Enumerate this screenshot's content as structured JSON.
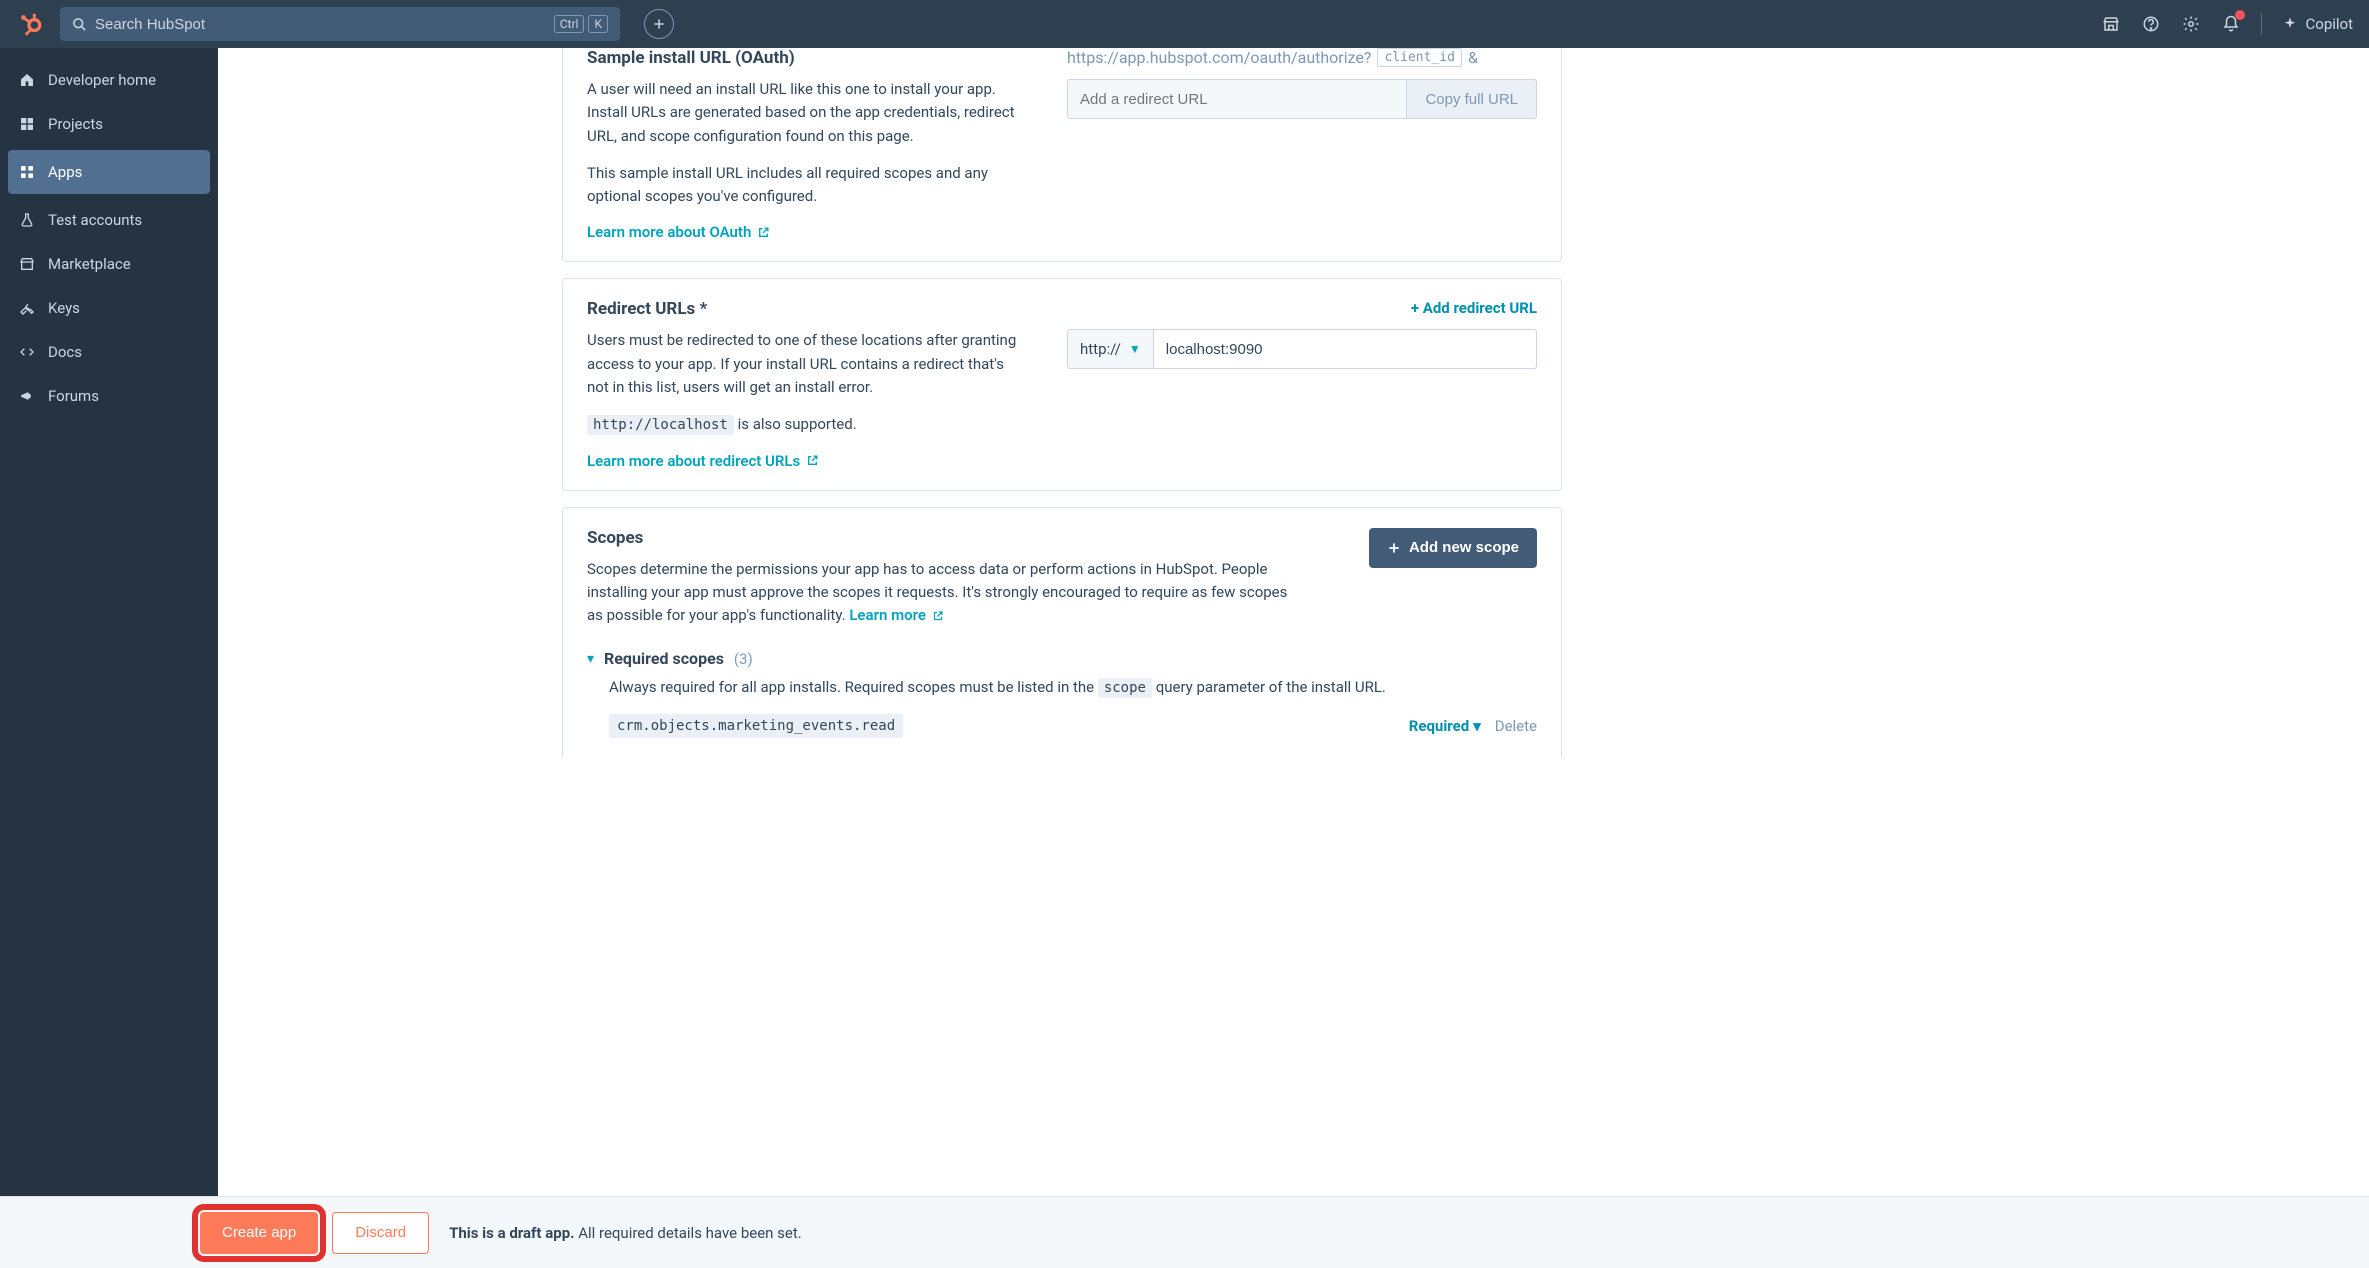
{
  "topbar": {
    "search_placeholder": "Search HubSpot",
    "kbd_ctrl": "Ctrl",
    "kbd_k": "K",
    "copilot_label": "Copilot"
  },
  "sidebar": {
    "items": [
      {
        "label": "Developer home"
      },
      {
        "label": "Projects"
      },
      {
        "label": "Apps"
      },
      {
        "label": "Test accounts"
      },
      {
        "label": "Marketplace"
      },
      {
        "label": "Keys"
      },
      {
        "label": "Docs"
      },
      {
        "label": "Forums"
      }
    ]
  },
  "oauth": {
    "title": "Sample install URL (OAuth)",
    "desc1": "A user will need an install URL like this one to install your app. Install URLs are generated based on the app credentials, redirect URL, and scope configuration found on this page.",
    "desc2": "This sample install URL includes all required scopes and any optional scopes you've configured.",
    "learn_more": "Learn more about OAuth",
    "url_prefix": "https://app.hubspot.com/oauth/authorize?",
    "url_chip": "client_id",
    "url_amp": "&",
    "input_placeholder": "Add a redirect URL",
    "copy_btn": "Copy full URL"
  },
  "redirect": {
    "title": "Redirect URLs *",
    "desc": "Users must be redirected to one of these locations after granting access to your app. If your install URL contains a redirect that's not in this list, users will get an install error.",
    "localhost_code": "http://localhost",
    "localhost_tail": " is also supported.",
    "learn_more": "Learn more about redirect URLs",
    "add_btn": "+ Add redirect URL",
    "proto": "http://",
    "host_value": "localhost:9090"
  },
  "scopes": {
    "title": "Scopes",
    "desc": "Scopes determine the permissions your app has to access data or perform actions in HubSpot. People installing your app must approve the scopes it requests. It's strongly encouraged to require as few scopes as possible for your app's functionality. ",
    "learn_more": "Learn more",
    "add_btn": "Add new scope",
    "required_title": "Required scopes",
    "required_count": "(3)",
    "required_desc_pre": "Always required for all app installs. Required scopes must be listed in the ",
    "required_desc_code": "scope",
    "required_desc_post": " query parameter of the install URL.",
    "scope_item": "crm.objects.marketing_events.read",
    "required_dd": "Required",
    "delete": "Delete"
  },
  "footer": {
    "create_btn": "Create app",
    "discard_btn": "Discard",
    "msg_bold": "This is a draft app.",
    "msg_tail": " All required details have been set."
  }
}
